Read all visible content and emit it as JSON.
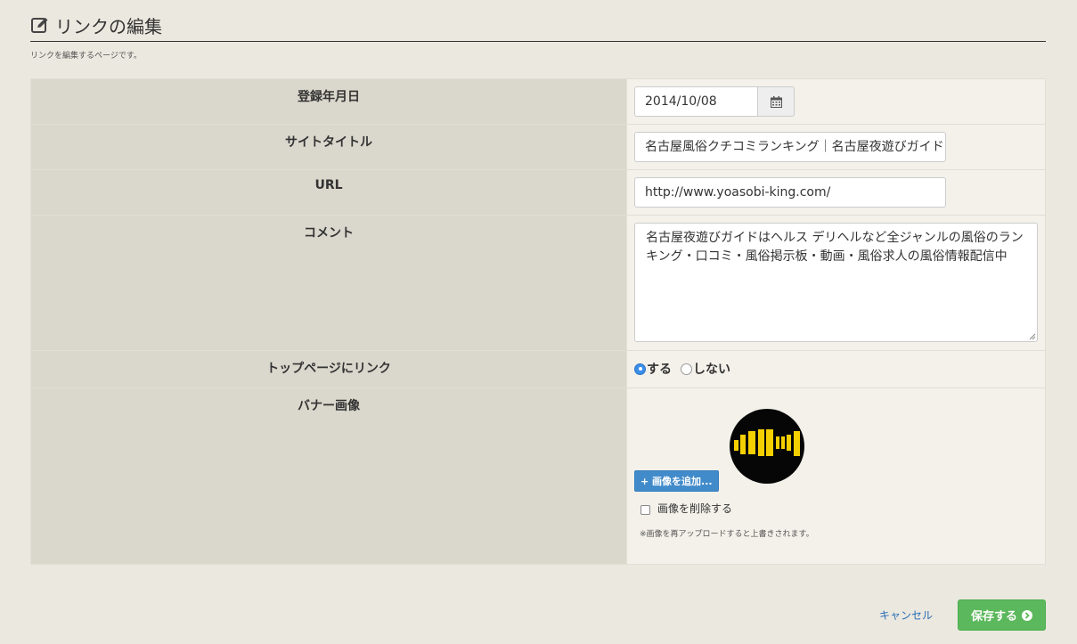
{
  "header": {
    "title": "リンクの編集",
    "description": "リンクを編集するページです。"
  },
  "form": {
    "date": {
      "label": "登録年月日",
      "value": "2014/10/08"
    },
    "site_title": {
      "label": "サイトタイトル",
      "value": "名古屋風俗クチコミランキング｜名古屋夜遊びガイド"
    },
    "url": {
      "label": "URL",
      "value": "http://www.yoasobi-king.com/"
    },
    "comment": {
      "label": "コメント",
      "value": "名古屋夜遊びガイドはヘルス デリヘルなど全ジャンルの風俗のランキング・口コミ・風俗掲示板・動画・風俗求人の風俗情報配信中"
    },
    "top_link": {
      "label": "トップページにリンク",
      "option_yes": "する",
      "option_no": "しない",
      "selected": "する"
    },
    "banner": {
      "label": "バナー画像",
      "add_button": "+ 画像を追加...",
      "delete_label": "画像を削除する",
      "note": "※画像を再アップロードすると上書きされます。"
    }
  },
  "actions": {
    "cancel": "キャンセル",
    "save": "保存する"
  },
  "colors": {
    "primary": "#428bca",
    "success": "#5cb85c",
    "label_bg": "#dad8cd",
    "page_bg": "#ebe8df"
  }
}
